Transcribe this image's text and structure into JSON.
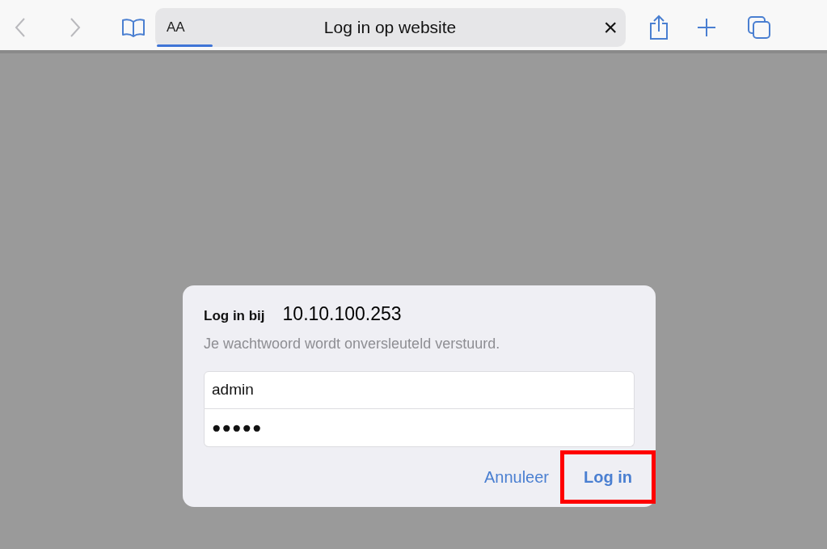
{
  "toolbar": {
    "reader_label": "AA",
    "page_title": "Log in op website",
    "close_label": "×",
    "load_progress": {
      "level": 0.12
    }
  },
  "dialog": {
    "title": "Log in bij",
    "host": "10.10.100.253",
    "message": "Je wachtwoord wordt onversleuteld verstuurd.",
    "fields": [
      {
        "kind": "text",
        "value": "admin"
      },
      {
        "kind": "password",
        "value": "●●●●●"
      }
    ],
    "buttons": [
      {
        "label": "Annuleer",
        "highlighted": false,
        "bold": false
      },
      {
        "label": "Log in",
        "highlighted": true,
        "bold": true
      }
    ]
  }
}
